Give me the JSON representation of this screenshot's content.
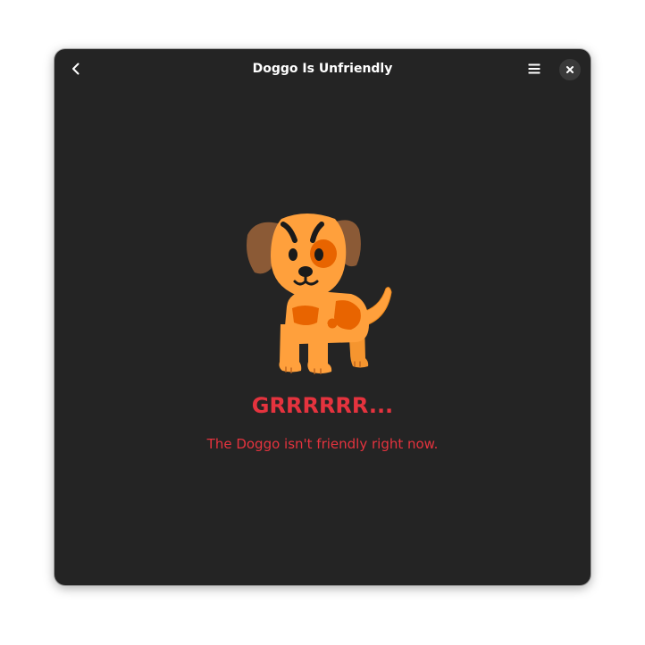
{
  "window": {
    "title": "Doggo Is Unfriendly"
  },
  "header": {
    "back_icon": "go-previous-icon",
    "menu_icon": "open-menu-icon",
    "close_icon": "window-close-icon"
  },
  "status": {
    "icon": "dog-illustration",
    "title": "GRRRRRR...",
    "description": "The Doggo isn't friendly right now."
  },
  "colors": {
    "window_bg": "#242424",
    "accent_red": "#e5333e",
    "dog_body": "#ffa03c",
    "dog_ear": "#8b5a36",
    "dog_spot": "#e86400"
  }
}
